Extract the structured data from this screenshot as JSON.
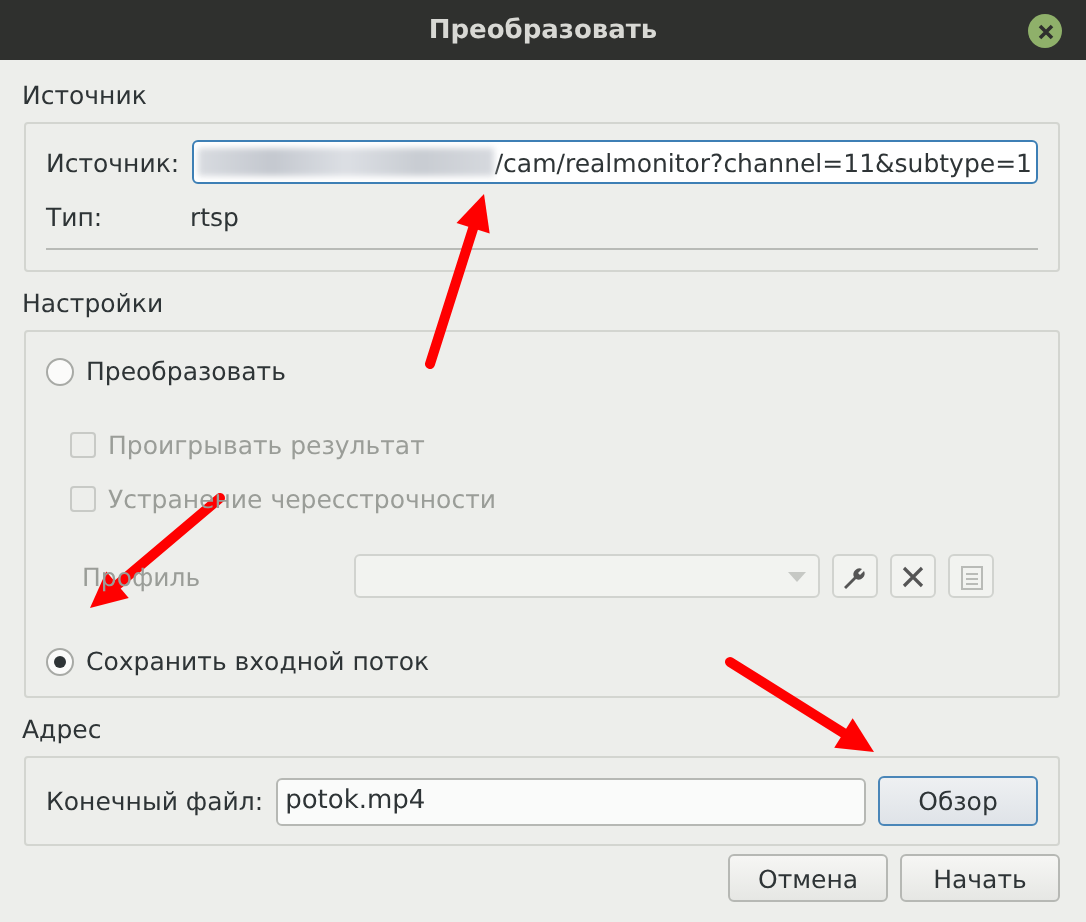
{
  "window": {
    "title": "Преобразовать"
  },
  "source": {
    "heading": "Источник",
    "field_label": "Источник:",
    "field_value": "/cam/realmonitor?channel=11&subtype=1",
    "type_label": "Тип:",
    "type_value": "rtsp"
  },
  "settings": {
    "heading": "Настройки",
    "options": [
      {
        "kind": "radio",
        "label": "Преобразовать",
        "selected": false,
        "disabled": false
      },
      {
        "kind": "checkbox",
        "label": "Проигрывать результат",
        "checked": false,
        "disabled": true
      },
      {
        "kind": "checkbox",
        "label": "Устранение чересстрочности",
        "checked": false,
        "disabled": true
      },
      {
        "kind": "profile",
        "label": "Профиль",
        "disabled": true
      },
      {
        "kind": "radio",
        "label": "Сохранить входной поток",
        "selected": true,
        "disabled": false
      }
    ]
  },
  "destination": {
    "heading": "Адрес",
    "field_label": "Конечный файл:",
    "field_value": "potok.mp4",
    "browse_button": "Обзор"
  },
  "buttons": [
    "Отмена",
    "Начать"
  ]
}
